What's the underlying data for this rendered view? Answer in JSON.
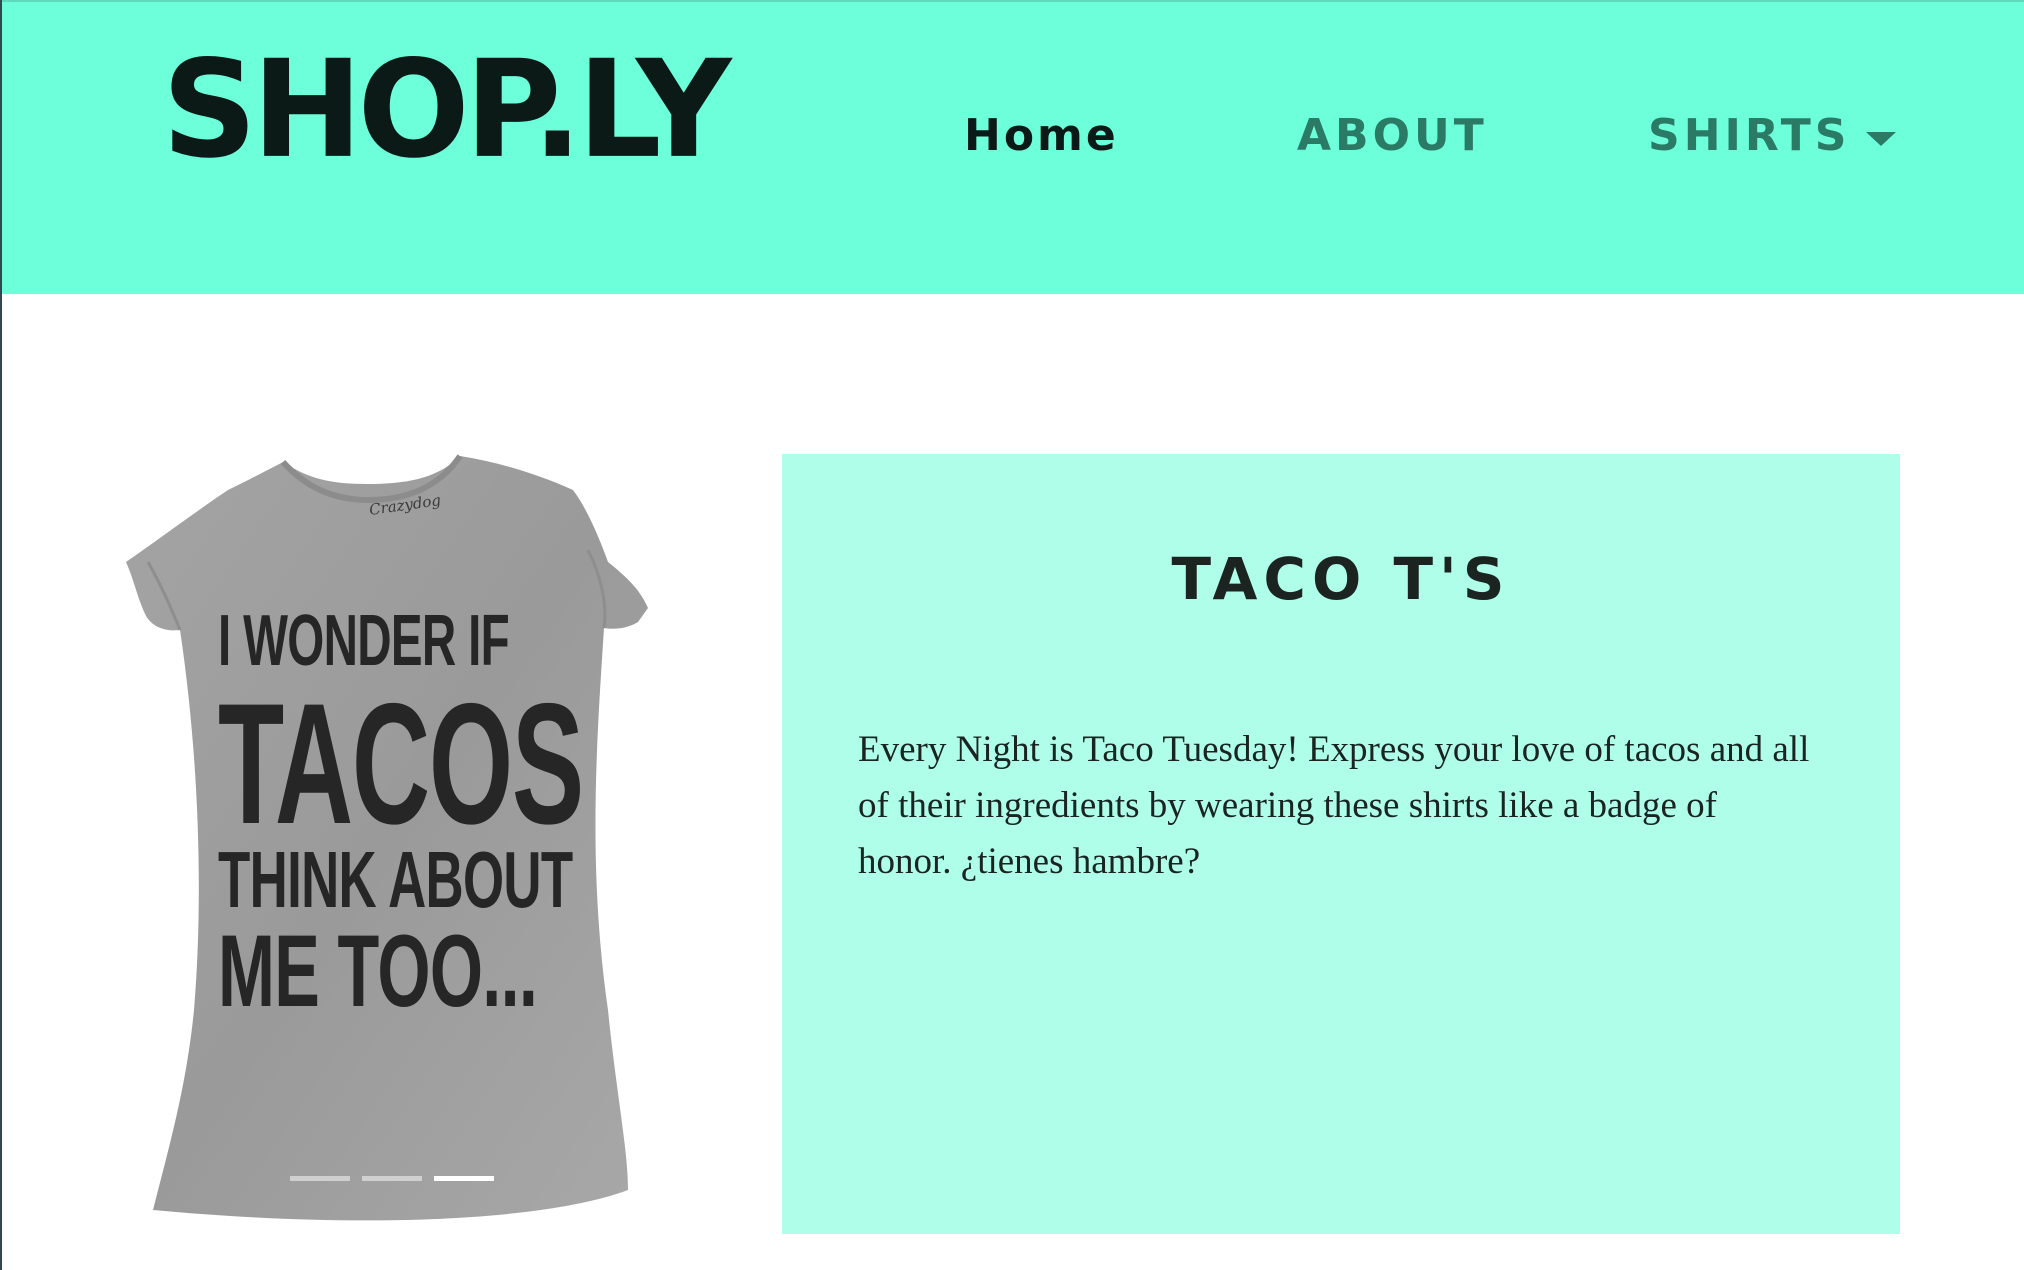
{
  "header": {
    "logo": "SHOP.LY",
    "nav": {
      "home": "Home",
      "about": "ABOUT",
      "shirts": "SHIRTS"
    },
    "dropdown_icon": "chevron-down-icon"
  },
  "carousel": {
    "slide": {
      "brand": "Crazydog",
      "lines": [
        "I WONDER IF",
        "TACOS",
        "THINK  ABOUT",
        "ME TOO..."
      ]
    },
    "indicators_count": 3,
    "active_indicator": 3
  },
  "panel": {
    "title": "TACO  T'S",
    "description": "Every Night is Taco Tuesday! Express your love of tacos and all of their ingredients by wearing these shirts like a badge of honor. ¿tienes hambre?"
  },
  "colors": {
    "header_bg": "#6cffd9",
    "panel_bg": "#aefee9",
    "nav_active": "#0c1a17",
    "nav_inactive": "#2b7a66"
  }
}
